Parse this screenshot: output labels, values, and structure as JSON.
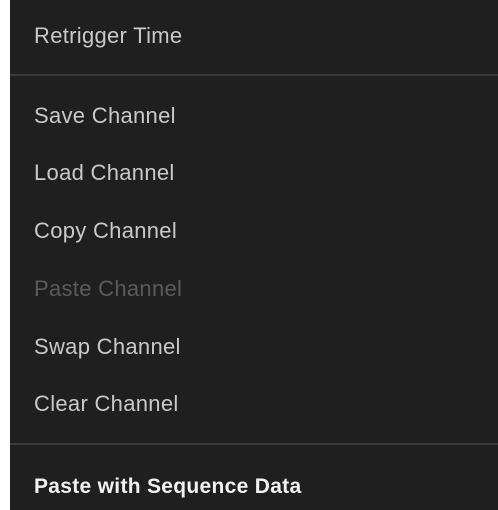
{
  "context_menu": {
    "items": [
      {
        "label": "Retrigger Time"
      },
      {
        "label": "Save Channel"
      },
      {
        "label": "Load Channel"
      },
      {
        "label": "Copy Channel"
      },
      {
        "label": "Paste Channel",
        "disabled": true
      },
      {
        "label": "Swap Channel"
      },
      {
        "label": "Clear Channel"
      },
      {
        "label": "Paste with Sequence Data"
      }
    ]
  },
  "colors": {
    "background": "#1f1f1f",
    "text": "#c9c9c9",
    "disabled_text": "#5b5b5b",
    "emphasis_text": "#f2f2f2",
    "separator": "#3a3a3a"
  }
}
